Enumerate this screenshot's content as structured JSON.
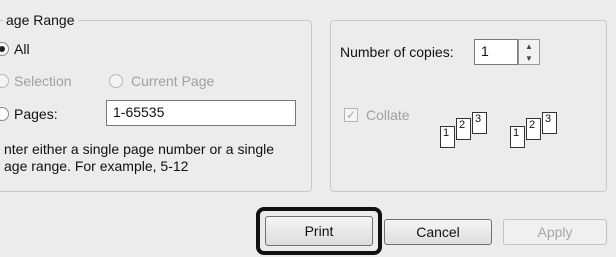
{
  "page_range": {
    "legend": "age Range",
    "all_label": "All",
    "selection_label": "Selection",
    "current_page_label": "Current Page",
    "pages_label": "Pages:",
    "pages_value": "1-65535",
    "help_line1": "nter either a single page number or a single",
    "help_line2": "age range.  For example, 5-12"
  },
  "copies": {
    "label": "Number of copies:",
    "value": "1",
    "collate_label": "Collate",
    "collate_checked": true,
    "collate_pages": [
      "1",
      "2",
      "3"
    ]
  },
  "buttons": {
    "print": "Print",
    "cancel": "Cancel",
    "apply": "Apply"
  },
  "icons": {
    "spin_up": "▲",
    "spin_down": "▼",
    "checkmark": "✓"
  }
}
